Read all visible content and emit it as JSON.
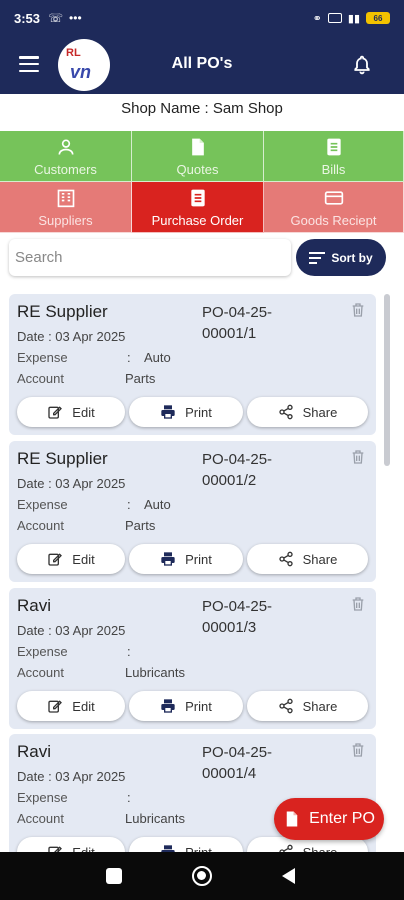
{
  "status_bar": {
    "time": "3:53",
    "battery": "66"
  },
  "app_bar": {
    "title": "All PO's",
    "logo_top": "RL",
    "logo_bottom": "vn"
  },
  "shop": {
    "label": "Shop Name : Sam Shop"
  },
  "categories": [
    {
      "label": "Customers",
      "icon": "person-icon"
    },
    {
      "label": "Quotes",
      "icon": "document-icon"
    },
    {
      "label": "Bills",
      "icon": "list-document-icon"
    },
    {
      "label": "Suppliers",
      "icon": "building-icon"
    },
    {
      "label": "Purchase Order",
      "icon": "list-document-icon"
    },
    {
      "label": "Goods Reciept",
      "icon": "card-icon"
    }
  ],
  "colors": {
    "header": "#1e2a5a",
    "green": "#76c35a",
    "pink": "#e57a77",
    "active_red": "#d9231f",
    "card_bg": "#e4e9f3"
  },
  "search": {
    "placeholder": "Search"
  },
  "sort": {
    "label": "Sort by"
  },
  "card_labels": {
    "expense": "Expense",
    "account": "Account",
    "colon": ":",
    "edit": "Edit",
    "print": "Print",
    "share": "Share"
  },
  "orders": [
    {
      "supplier": "RE Supplier",
      "date": "Date : 03 Apr 2025",
      "po_line1": "PO-04-25-",
      "po_line2": "00001/1",
      "account1": "Auto",
      "account2": "Parts"
    },
    {
      "supplier": "RE Supplier",
      "date": "Date : 03 Apr 2025",
      "po_line1": "PO-04-25-",
      "po_line2": "00001/2",
      "account1": "Auto",
      "account2": "Parts"
    },
    {
      "supplier": "Ravi",
      "date": "Date : 03 Apr 2025",
      "po_line1": "PO-04-25-",
      "po_line2": "00001/3",
      "account1": "",
      "account2": "Lubricants"
    },
    {
      "supplier": "Ravi",
      "date": "Date : 03 Apr 2025",
      "po_line1": "PO-04-25-",
      "po_line2": "00001/4",
      "account1": "",
      "account2": "Lubricants"
    }
  ],
  "fab": {
    "label": "Enter PO"
  }
}
